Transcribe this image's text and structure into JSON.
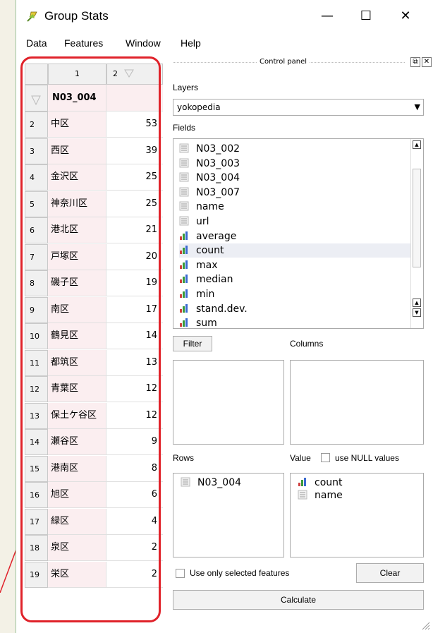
{
  "window": {
    "title": "Group Stats",
    "minimize": "—",
    "maximize": "☐",
    "close": "✕"
  },
  "menu": [
    "Data",
    "Features",
    "Window",
    "Help"
  ],
  "table": {
    "col1": "1",
    "col2": "2",
    "header_label": "N03_004",
    "rows": [
      {
        "n": "2",
        "name": "中区",
        "val": "53"
      },
      {
        "n": "3",
        "name": "西区",
        "val": "39"
      },
      {
        "n": "4",
        "name": "金沢区",
        "val": "25"
      },
      {
        "n": "5",
        "name": "神奈川区",
        "val": "25"
      },
      {
        "n": "6",
        "name": "港北区",
        "val": "21"
      },
      {
        "n": "7",
        "name": "戸塚区",
        "val": "20"
      },
      {
        "n": "8",
        "name": "磯子区",
        "val": "19"
      },
      {
        "n": "9",
        "name": "南区",
        "val": "17"
      },
      {
        "n": "10",
        "name": "鶴見区",
        "val": "14"
      },
      {
        "n": "11",
        "name": "都筑区",
        "val": "13"
      },
      {
        "n": "12",
        "name": "青葉区",
        "val": "12"
      },
      {
        "n": "13",
        "name": "保土ケ谷区",
        "val": "12"
      },
      {
        "n": "14",
        "name": "瀬谷区",
        "val": "9"
      },
      {
        "n": "15",
        "name": "港南区",
        "val": "8"
      },
      {
        "n": "16",
        "name": "旭区",
        "val": "6"
      },
      {
        "n": "17",
        "name": "緑区",
        "val": "4"
      },
      {
        "n": "18",
        "name": "泉区",
        "val": "2"
      },
      {
        "n": "19",
        "name": "栄区",
        "val": "2"
      }
    ]
  },
  "control_panel": {
    "title": "Control panel",
    "layers_label": "Layers",
    "layer_selected": "yokopedia",
    "fields_label": "Fields",
    "fields": [
      {
        "name": "N03_002",
        "icon": "text"
      },
      {
        "name": "N03_003",
        "icon": "text"
      },
      {
        "name": "N03_004",
        "icon": "text"
      },
      {
        "name": "N03_007",
        "icon": "text"
      },
      {
        "name": "name",
        "icon": "text"
      },
      {
        "name": "url",
        "icon": "text"
      },
      {
        "name": "average",
        "icon": "bar"
      },
      {
        "name": "count",
        "icon": "bar"
      },
      {
        "name": "max",
        "icon": "bar"
      },
      {
        "name": "median",
        "icon": "bar"
      },
      {
        "name": "min",
        "icon": "bar"
      },
      {
        "name": "stand.dev.",
        "icon": "bar"
      },
      {
        "name": "sum",
        "icon": "bar"
      }
    ],
    "selected_field": "count",
    "filter_label": "Filter",
    "columns_label": "Columns",
    "rows_label": "Rows",
    "value_label": "Value",
    "use_null_label": "use NULL values",
    "rows_items": [
      "N03_004"
    ],
    "value_items": [
      {
        "name": "count",
        "icon": "bar"
      },
      {
        "name": "name",
        "icon": "text"
      }
    ],
    "use_selected_label": "Use only selected features",
    "clear_label": "Clear",
    "calculate_label": "Calculate"
  }
}
